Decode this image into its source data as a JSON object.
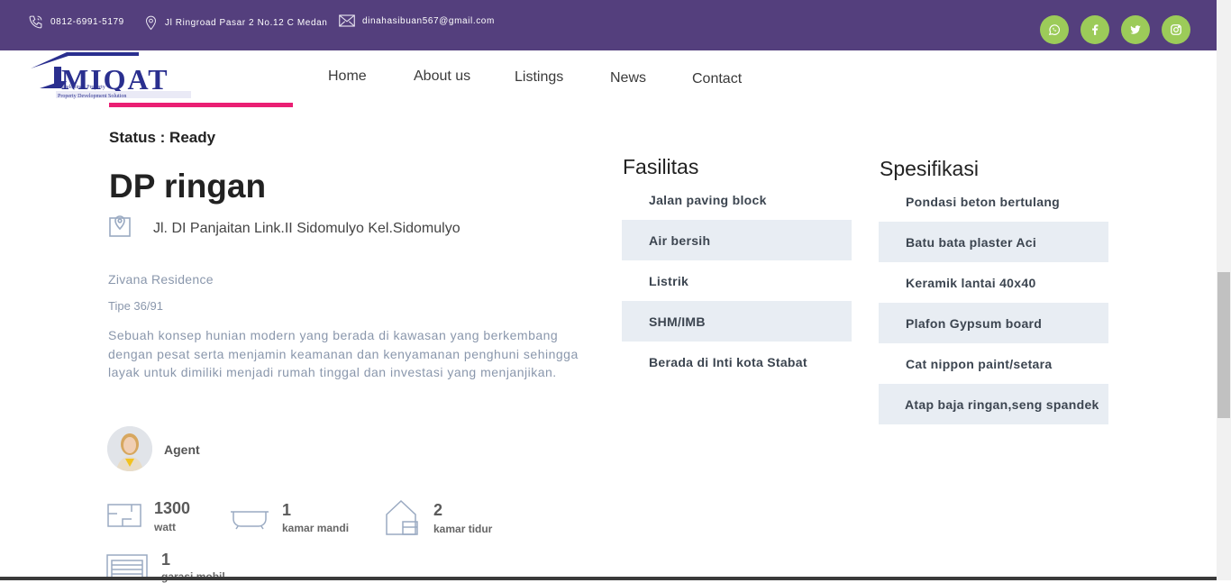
{
  "topbar": {
    "phone": "0812-6991-5179",
    "address": "Jl Ringroad Pasar 2 No.12 C Medan",
    "email": "dinahasibuan567@gmail.com",
    "social": [
      "whatsapp-icon",
      "facebook-icon",
      "twitter-icon",
      "instagram-icon"
    ],
    "bg_color": "#543f7d",
    "social_color": "#9ccb59"
  },
  "logo": {
    "text": "IMIQAT",
    "tagline": "Developinda Property",
    "subtagline": "Property Development Solution"
  },
  "nav": {
    "home": "Home",
    "about": "About us",
    "listings": "Listings",
    "news": "News",
    "contact": "Contact"
  },
  "property": {
    "status": "Status : Ready",
    "title": "DP ringan",
    "address": "Jl. DI Panjaitan Link.II Sidomulyo Kel.Sidomulyo",
    "residence": "Zivana Residence",
    "tipe": "Tipe 36/91",
    "description": "Sebuah konsep hunian modern yang berada di kawasan yang berkembang dengan pesat serta menjamin keamanan dan kenyamanan penghuni sehingga layak untuk dimiliki menjadi rumah tinggal dan investasi yang menjanjikan."
  },
  "agent": {
    "label": "Agent"
  },
  "stats": {
    "watt": {
      "value": "1300",
      "label": "watt"
    },
    "bath": {
      "value": "1",
      "label": "kamar mandi"
    },
    "bed": {
      "value": "2",
      "label": "kamar tidur"
    },
    "garage": {
      "value": "1",
      "label": "garasi mobil"
    }
  },
  "fasilitas": {
    "heading": "Fasilitas",
    "items": [
      "Jalan paving block",
      "Air bersih",
      "Listrik",
      "SHM/IMB",
      "Berada di Inti kota Stabat"
    ]
  },
  "spesifikasi": {
    "heading": "Spesifikasi",
    "items": [
      "Pondasi beton bertulang",
      "Batu bata plaster Aci",
      "Keramik lantai 40x40",
      "Plafon Gypsum board",
      "Cat nippon paint/setara",
      "Atap baja ringan,seng spandek"
    ]
  }
}
